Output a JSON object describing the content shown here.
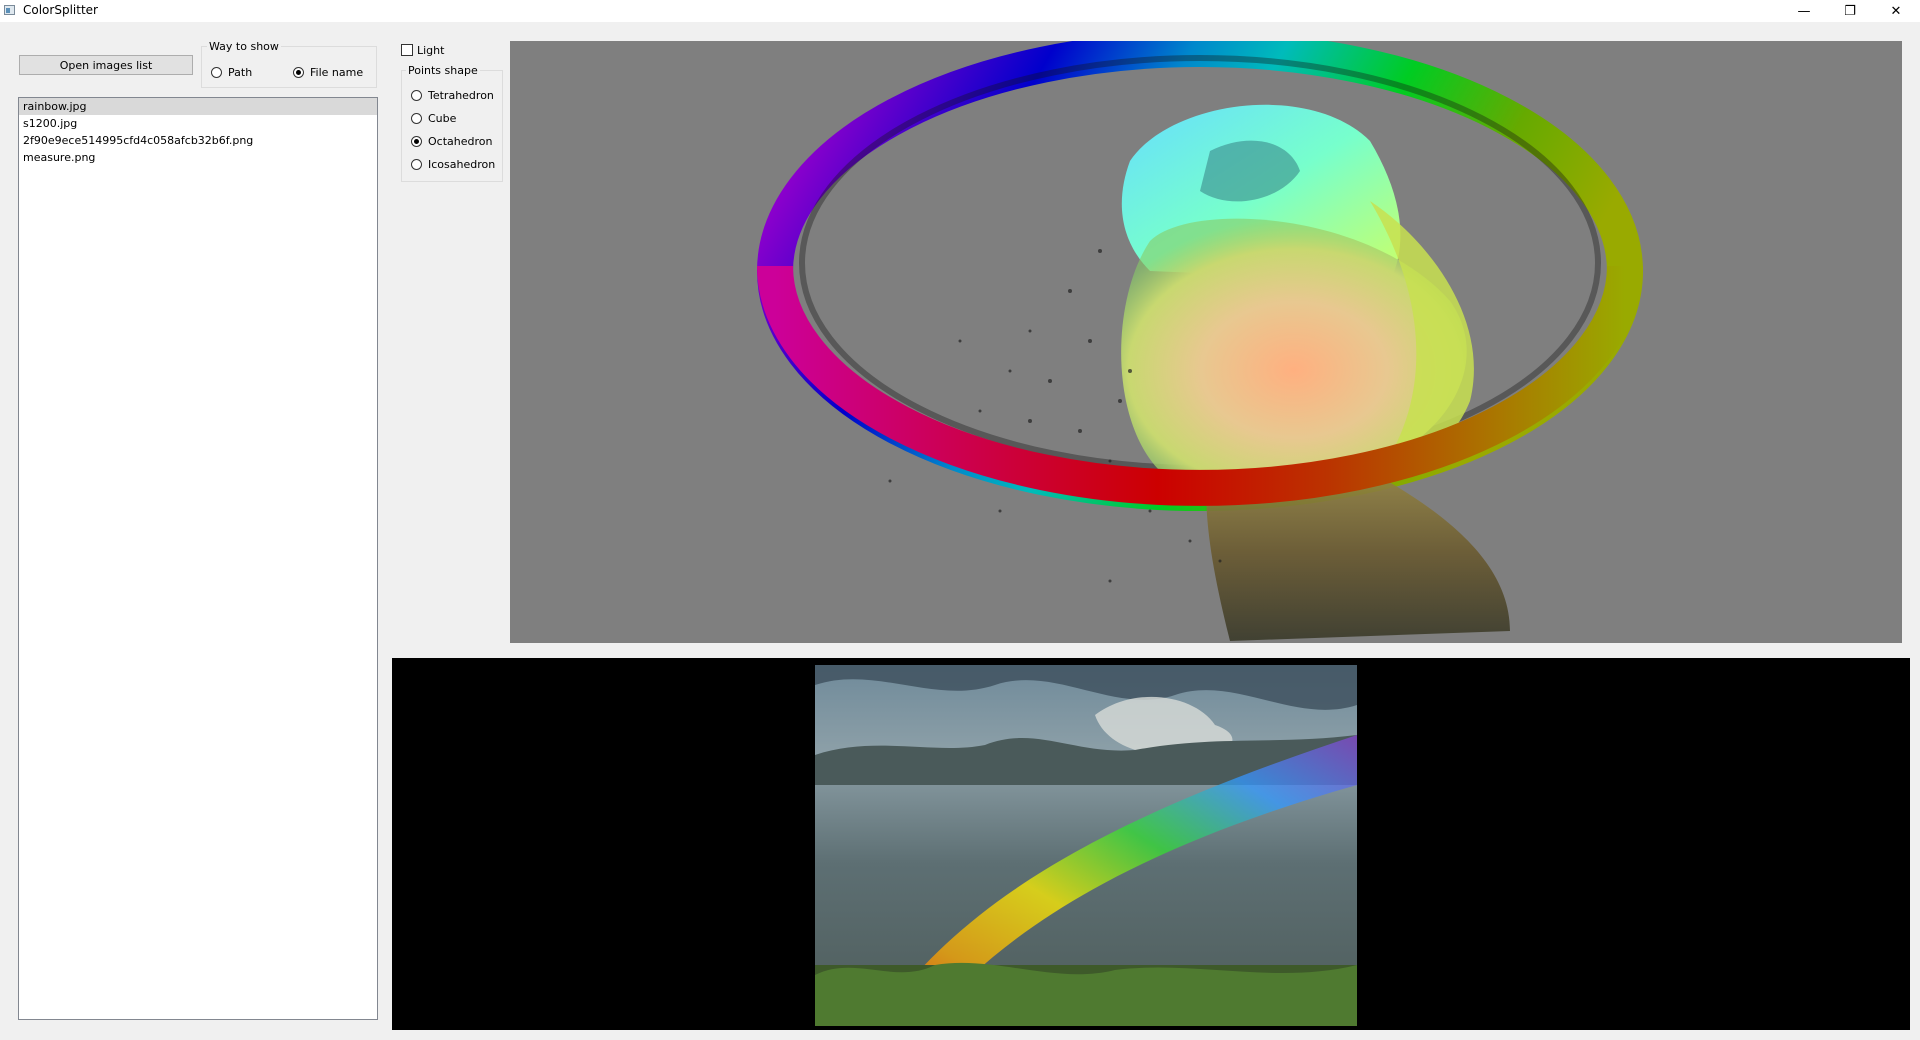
{
  "window": {
    "title": "ColorSplitter",
    "minimize_glyph": "—",
    "restore_glyph": "❐",
    "close_glyph": "✕"
  },
  "controls": {
    "open_button": "Open images list",
    "way_to_show": {
      "title": "Way to show",
      "options": [
        "Path",
        "File name"
      ],
      "selected": "File name"
    },
    "light_label": "Light",
    "light_checked": false,
    "points_shape": {
      "title": "Points shape",
      "options": [
        "Tetrahedron",
        "Cube",
        "Octahedron",
        "Icosahedron"
      ],
      "selected": "Octahedron"
    }
  },
  "file_list": {
    "items": [
      "rainbow.jpg",
      "s1200.jpg",
      "2f90e9ece514995cfd4c058afcb32b6f.png",
      "measure.png"
    ],
    "selected": "rainbow.jpg"
  },
  "colors": {
    "viewport_background": "#7f7f7f",
    "image_panel_background": "#000000",
    "selection": "#d9d9d9"
  }
}
